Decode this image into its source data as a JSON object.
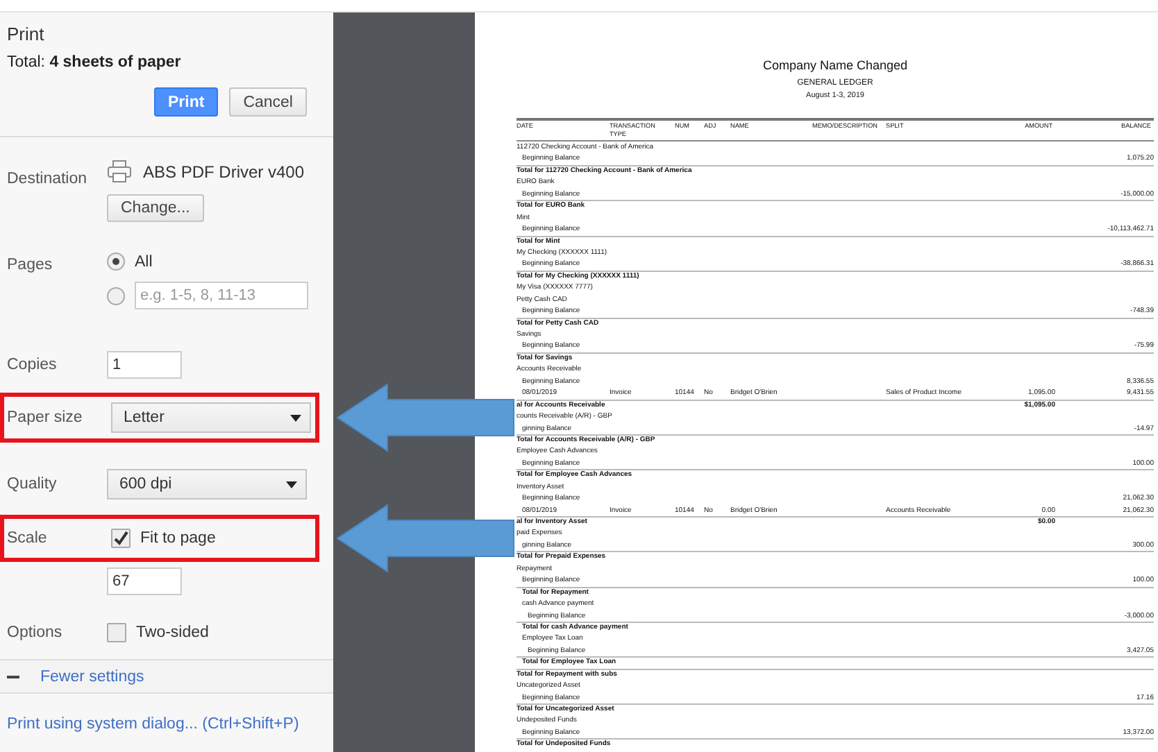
{
  "dialog": {
    "title": "Print",
    "total": "Total: **4 sheets of paper**",
    "buttons": [
      {
        "label": "Print",
        "kind": "primary"
      },
      {
        "label": "Cancel",
        "kind": "default"
      }
    ]
  },
  "settings": [
    {
      "kind": "destination",
      "label": "Destination",
      "value": "ABS PDF Driver v400",
      "button": "Change..."
    },
    {
      "kind": "pages",
      "label": "Pages",
      "options": [
        {
          "kind": "text",
          "label": "All",
          "selected": true
        },
        {
          "kind": "field",
          "placeholder": "e.g. 1-5, 8, 11-13",
          "selected": false
        }
      ]
    },
    {
      "kind": "input",
      "label": "Copies",
      "value": "1"
    },
    {
      "kind": "select",
      "label": "Paper size",
      "value": "Letter",
      "highlighted": true
    },
    {
      "kind": "select",
      "label": "Quality",
      "value": "600 dpi",
      "highlighted": false
    },
    {
      "kind": "checkbox",
      "label": "Scale",
      "option": "Fit to page",
      "checked": true,
      "highlighted": true
    },
    {
      "kind": "input",
      "value": "67"
    },
    {
      "kind": "checkbox",
      "label": "Options",
      "option": "Two-sided",
      "checked": false,
      "highlighted": false
    }
  ],
  "fewer_settings": "Fewer settings",
  "system_dialog_link": "Print using system dialog... (Ctrl+Shift+P)",
  "preview": {
    "title": "Company Name Changed",
    "subtitle": "GENERAL LEDGER",
    "period": "August 1-3, 2019",
    "columns": [
      "DATE",
      "TRANSACTION TYPE",
      "NUM",
      "ADJ",
      "NAME",
      "MEMO/DESCRIPTION",
      "SPLIT",
      "AMOUNT",
      "BALANCE"
    ],
    "accounts": [
      {
        "name": "112720 Checking Account - Bank of America",
        "lines": [
          {
            "kind": "balance",
            "text": "Beginning Balance",
            "balance": "1,075.20"
          }
        ],
        "total": "Total for 112720 Checking Account - Bank of America"
      },
      {
        "name": "EURO Bank",
        "lines": [
          {
            "kind": "balance",
            "text": "Beginning Balance",
            "balance": "-15,000.00"
          }
        ],
        "total": "Total for EURO Bank"
      },
      {
        "name": "Mint",
        "lines": [
          {
            "kind": "balance",
            "text": "Beginning Balance",
            "balance": "-10,113,462.71"
          }
        ],
        "total": "Total for Mint"
      },
      {
        "name": "My Checking (XXXXXX 1111)",
        "lines": [
          {
            "kind": "balance",
            "text": "Beginning Balance",
            "balance": "-38,866.31"
          }
        ],
        "total": "Total for My Checking (XXXXXX 1111)"
      },
      {
        "name": "My Visa (XXXXXX 7777)"
      },
      {
        "name": "Petty Cash CAD",
        "lines": [
          {
            "kind": "balance",
            "text": "Beginning Balance",
            "balance": "-748.39"
          }
        ],
        "total": "Total for Petty Cash CAD"
      },
      {
        "name": "Savings",
        "lines": [
          {
            "kind": "balance",
            "text": "Beginning Balance",
            "balance": "-75.99"
          }
        ],
        "total": "Total for Savings"
      },
      {
        "name": "Accounts Receivable",
        "lines": [
          {
            "kind": "balance",
            "text": "Beginning Balance",
            "balance": "8,336.55"
          },
          {
            "kind": "txn",
            "date": "08/01/2019",
            "type": "Invoice",
            "num": "10144",
            "adj": "No",
            "name": "Bridget O'Brien",
            "split": "Sales of Product Income",
            "amount": "1,095.00",
            "balance": "9,431.55"
          }
        ],
        "total": "al for Accounts Receivable",
        "total_amount": "$1,095.00"
      },
      {
        "name": "counts Receivable (A/R) - GBP",
        "lines": [
          {
            "kind": "balance",
            "text": "ginning Balance",
            "balance": "-14.97"
          }
        ],
        "total": "Total for Accounts Receivable (A/R) - GBP"
      },
      {
        "name": "Employee Cash Advances",
        "lines": [
          {
            "kind": "balance",
            "text": "Beginning Balance",
            "balance": "100.00"
          }
        ],
        "total": "Total for Employee Cash Advances"
      },
      {
        "name": "Inventory Asset",
        "lines": [
          {
            "kind": "balance",
            "text": "Beginning Balance",
            "balance": "21,062.30"
          },
          {
            "kind": "txn",
            "date": "08/01/2019",
            "type": "Invoice",
            "num": "10144",
            "adj": "No",
            "name": "Bridget O'Brien",
            "split": "Accounts Receivable",
            "amount": "0.00",
            "balance": "21,062.30"
          }
        ],
        "total": "al for Inventory Asset",
        "total_amount": "$0.00"
      },
      {
        "name": "paid Expenses",
        "lines": [
          {
            "kind": "balance",
            "text": "ginning Balance",
            "balance": "300.00"
          }
        ],
        "total": "Total for Prepaid Expenses"
      },
      {
        "name": "Repayment",
        "lines": [
          {
            "kind": "balance",
            "text": "Beginning Balance",
            "balance": "100.00"
          }
        ],
        "children": [
          {
            "total": "Total for Repayment"
          },
          {
            "name": "cash Advance payment",
            "lines": [
              {
                "kind": "balance",
                "text": "Beginning Balance",
                "balance": "-3,000.00"
              }
            ],
            "total": "Total for cash Advance payment"
          },
          {
            "name": "Employee Tax Loan",
            "lines": [
              {
                "kind": "balance",
                "text": "Beginning Balance",
                "balance": "3,427.05"
              }
            ],
            "total": "Total for Employee Tax Loan"
          }
        ],
        "total": "Total for Repayment with subs"
      },
      {
        "name": "Uncategorized Asset",
        "lines": [
          {
            "kind": "balance",
            "text": "Beginning Balance",
            "balance": "17.16"
          }
        ],
        "total": "Total for Uncategorized Asset"
      },
      {
        "name": "Undeposited Funds",
        "lines": [
          {
            "kind": "balance",
            "text": "Beginning Balance",
            "balance": "13,372.00"
          }
        ],
        "total": "Total for Undeposited Funds"
      }
    ]
  }
}
